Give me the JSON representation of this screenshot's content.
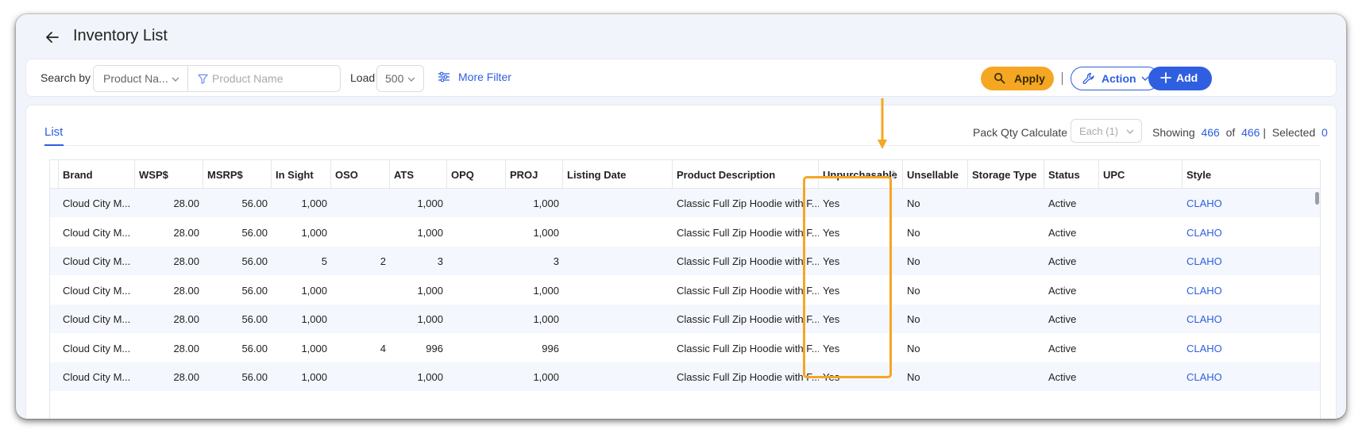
{
  "page": {
    "title": "Inventory List"
  },
  "filter_bar": {
    "search_by_label": "Search by",
    "search_by_value": "Product Na...",
    "search_placeholder": "Product Name",
    "load_label": "Load",
    "load_value": "500",
    "more_filter": "More Filter",
    "apply": "Apply",
    "action": "Action",
    "add": "Add"
  },
  "list": {
    "tab": "List",
    "pack_qty_label": "Pack Qty Calculate",
    "pack_qty_value": "Each (1)",
    "showing_label": "Showing",
    "showing_count": "466",
    "of_label": "of",
    "total_count": "466",
    "selected_label": "Selected",
    "selected_count": "0"
  },
  "table": {
    "columns": [
      "Brand",
      "WSP$",
      "MSRP$",
      "In Sight",
      "OSO",
      "ATS",
      "OPQ",
      "PROJ",
      "Listing Date",
      "Product Description",
      "Unpurchasable",
      "Unsellable",
      "Storage Type",
      "Status",
      "UPC",
      "Style"
    ],
    "rows": [
      {
        "brand": "Cloud City M...",
        "wsp": "28.00",
        "msrp": "56.00",
        "in_sight": "1,000",
        "oso": "",
        "ats": "1,000",
        "opq": "",
        "proj": "1,000",
        "listing_date": "",
        "description": "Classic Full Zip Hoodie with F...",
        "unpurchasable": "Yes",
        "unsellable": "No",
        "storage_type": "",
        "status": "Active",
        "upc": "",
        "style": "CLAHO"
      },
      {
        "brand": "Cloud City M...",
        "wsp": "28.00",
        "msrp": "56.00",
        "in_sight": "1,000",
        "oso": "",
        "ats": "1,000",
        "opq": "",
        "proj": "1,000",
        "listing_date": "",
        "description": "Classic Full Zip Hoodie with F...",
        "unpurchasable": "Yes",
        "unsellable": "No",
        "storage_type": "",
        "status": "Active",
        "upc": "",
        "style": "CLAHO"
      },
      {
        "brand": "Cloud City M...",
        "wsp": "28.00",
        "msrp": "56.00",
        "in_sight": "5",
        "oso": "2",
        "ats": "3",
        "opq": "",
        "proj": "3",
        "listing_date": "",
        "description": "Classic Full Zip Hoodie with F...",
        "unpurchasable": "Yes",
        "unsellable": "No",
        "storage_type": "",
        "status": "Active",
        "upc": "",
        "style": "CLAHO"
      },
      {
        "brand": "Cloud City M...",
        "wsp": "28.00",
        "msrp": "56.00",
        "in_sight": "1,000",
        "oso": "",
        "ats": "1,000",
        "opq": "",
        "proj": "1,000",
        "listing_date": "",
        "description": "Classic Full Zip Hoodie with F...",
        "unpurchasable": "Yes",
        "unsellable": "No",
        "storage_type": "",
        "status": "Active",
        "upc": "",
        "style": "CLAHO"
      },
      {
        "brand": "Cloud City M...",
        "wsp": "28.00",
        "msrp": "56.00",
        "in_sight": "1,000",
        "oso": "",
        "ats": "1,000",
        "opq": "",
        "proj": "1,000",
        "listing_date": "",
        "description": "Classic Full Zip Hoodie with F...",
        "unpurchasable": "Yes",
        "unsellable": "No",
        "storage_type": "",
        "status": "Active",
        "upc": "",
        "style": "CLAHO"
      },
      {
        "brand": "Cloud City M...",
        "wsp": "28.00",
        "msrp": "56.00",
        "in_sight": "1,000",
        "oso": "4",
        "ats": "996",
        "opq": "",
        "proj": "996",
        "listing_date": "",
        "description": "Classic Full Zip Hoodie with F...",
        "unpurchasable": "Yes",
        "unsellable": "No",
        "storage_type": "",
        "status": "Active",
        "upc": "",
        "style": "CLAHO"
      },
      {
        "brand": "Cloud City M...",
        "wsp": "28.00",
        "msrp": "56.00",
        "in_sight": "1,000",
        "oso": "",
        "ats": "1,000",
        "opq": "",
        "proj": "1,000",
        "listing_date": "",
        "description": "Classic Full Zip Hoodie with F...",
        "unpurchasable": "Yes",
        "unsellable": "No",
        "storage_type": "",
        "status": "Active",
        "upc": "",
        "style": "CLAHO"
      }
    ]
  },
  "colors": {
    "accent": "#2f5fe0",
    "apply": "#f5a623",
    "highlight": "#f5a623"
  },
  "icons": [
    "back-arrow-icon",
    "chevron-down-icon",
    "funnel-icon",
    "sliders-icon",
    "search-icon",
    "wrench-icon",
    "plus-icon",
    "sort-icon"
  ]
}
